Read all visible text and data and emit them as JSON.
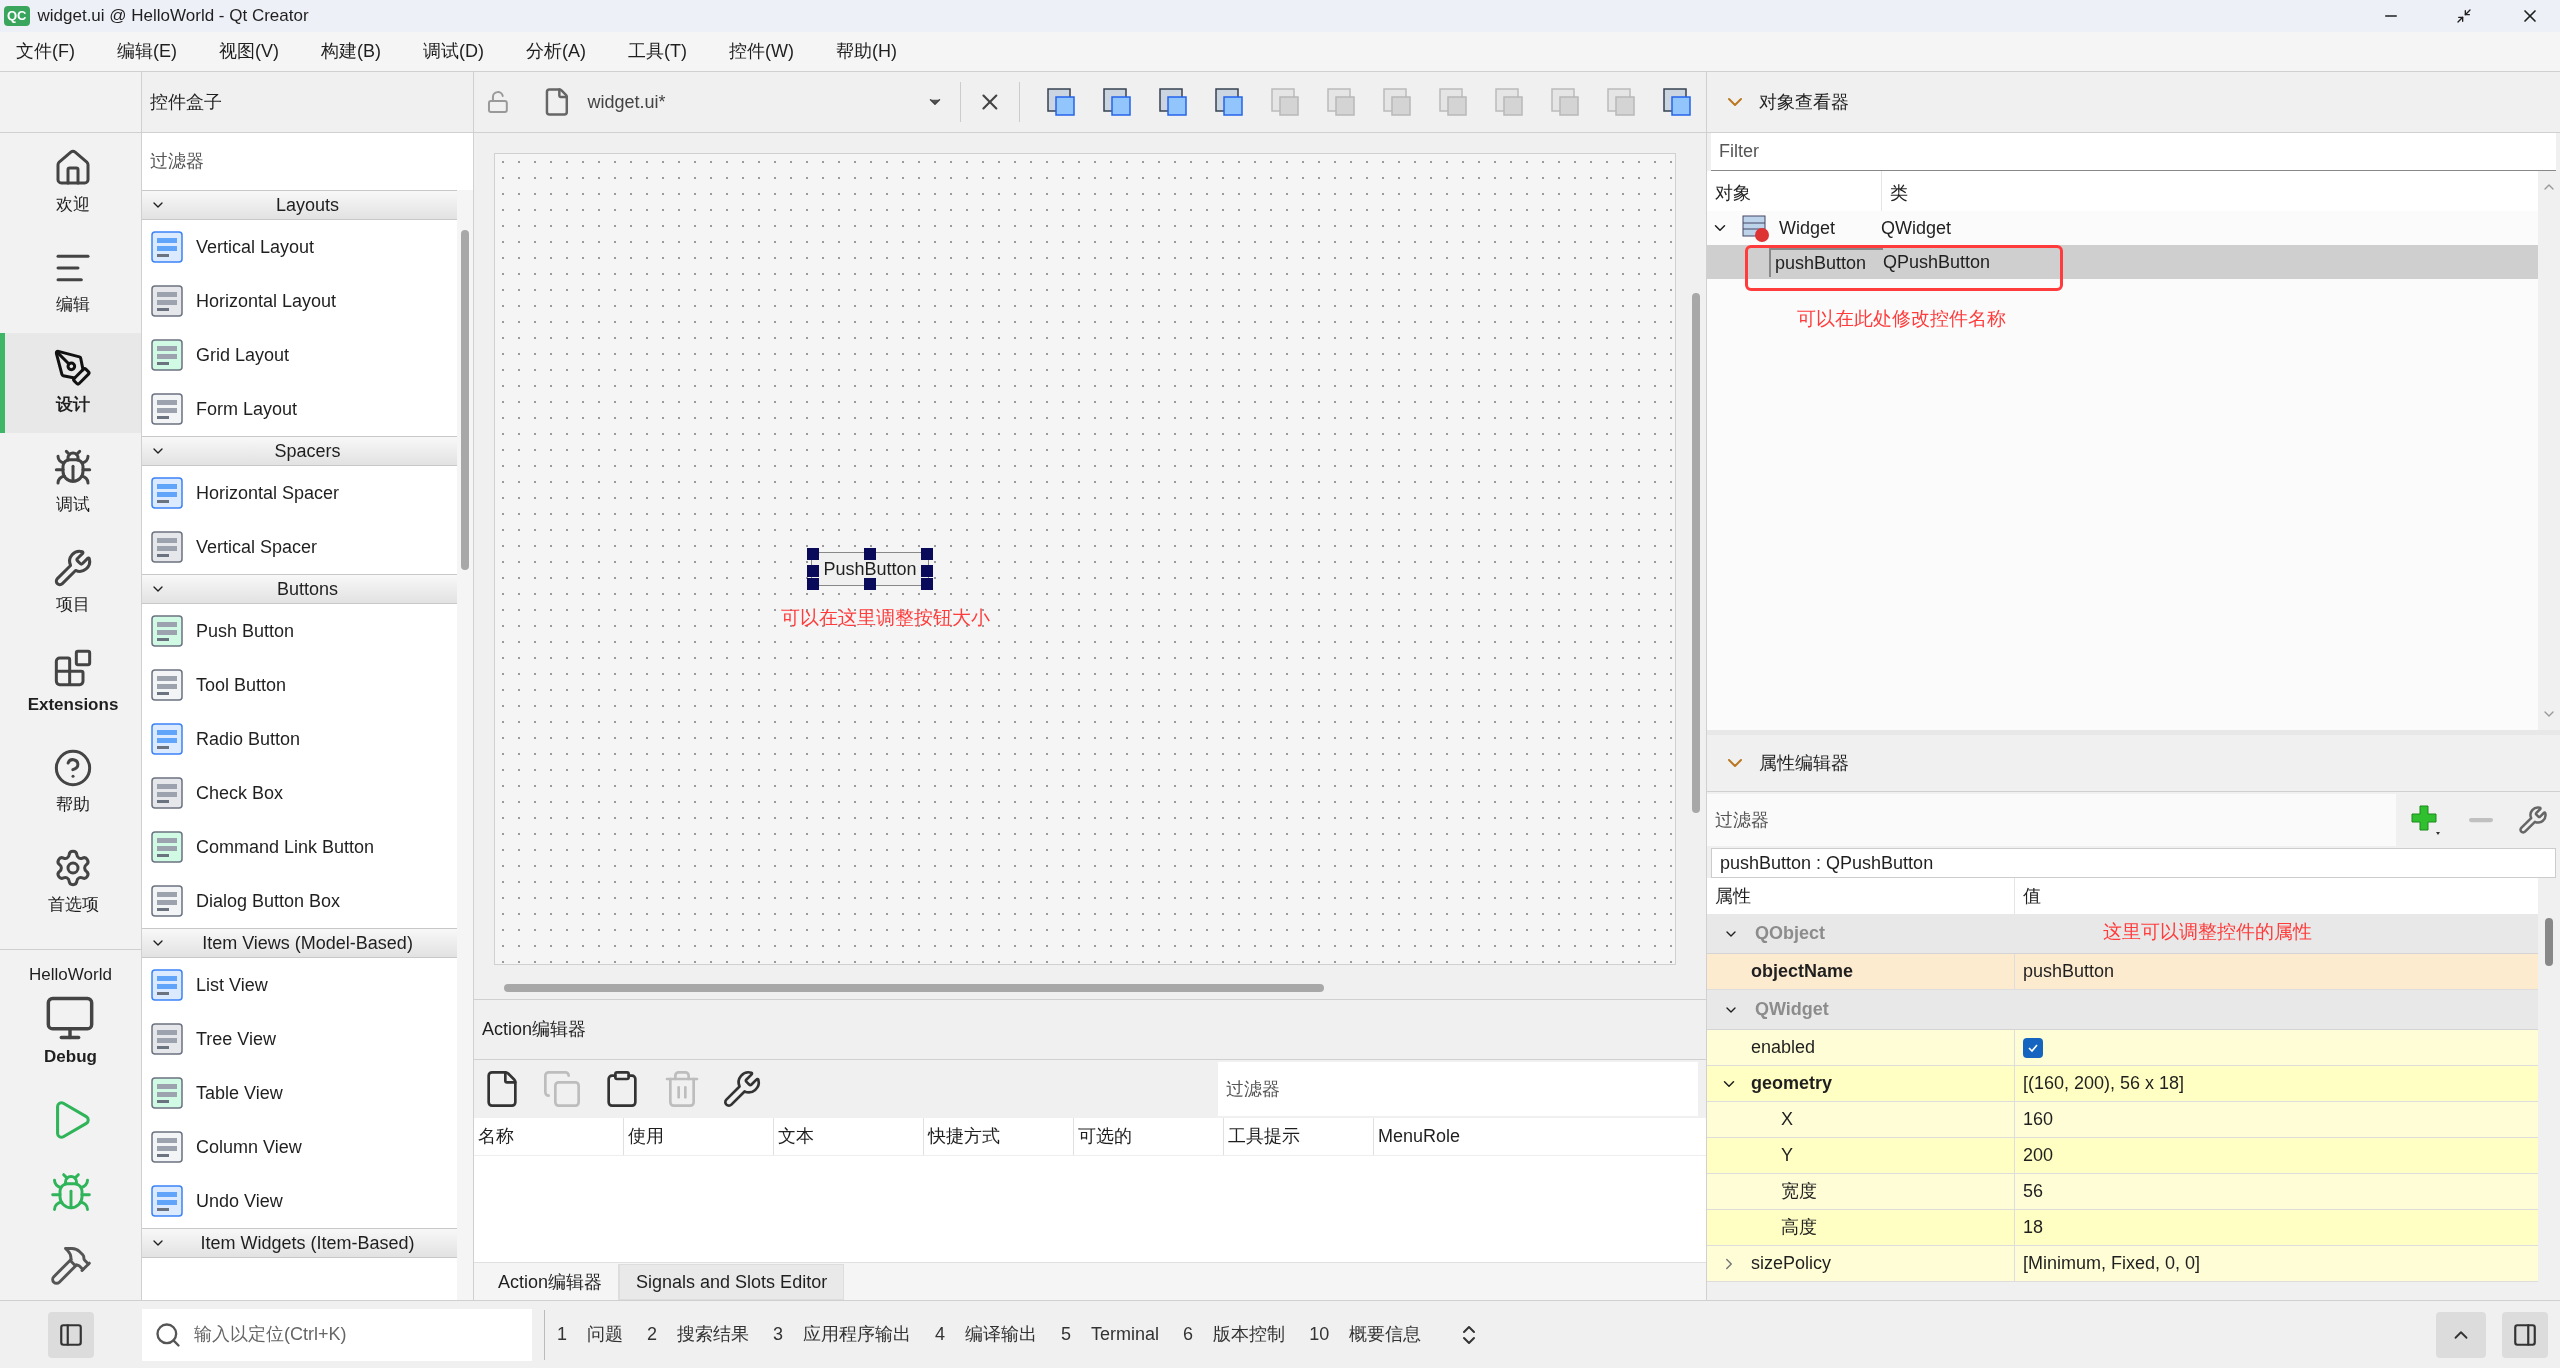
{
  "window": {
    "title": "widget.ui @ HelloWorld - Qt Creator",
    "app_badge": "QC"
  },
  "menu": [
    "文件(F)",
    "编辑(E)",
    "视图(V)",
    "构建(B)",
    "调试(D)",
    "分析(A)",
    "工具(T)",
    "控件(W)",
    "帮助(H)"
  ],
  "mode_bar": {
    "modes": [
      {
        "kind": "home",
        "label": "欢迎",
        "selected": false
      },
      {
        "kind": "edit",
        "label": "编辑",
        "selected": false
      },
      {
        "kind": "design",
        "label": "设计",
        "selected": true
      },
      {
        "kind": "debug",
        "label": "调试",
        "selected": false
      },
      {
        "kind": "project",
        "label": "项目",
        "selected": false
      },
      {
        "kind": "extensions",
        "label": "Extensions",
        "selected": false
      },
      {
        "kind": "help",
        "label": "帮助",
        "selected": false
      },
      {
        "kind": "settings",
        "label": "首选项",
        "selected": false
      }
    ],
    "project": "HelloWorld",
    "build_config": "Debug"
  },
  "widget_box": {
    "title": "控件盒子",
    "filter_placeholder": "过滤器",
    "sections": [
      {
        "name": "Layouts",
        "expanded": true,
        "items": [
          "Vertical Layout",
          "Horizontal Layout",
          "Grid Layout",
          "Form Layout"
        ]
      },
      {
        "name": "Spacers",
        "expanded": true,
        "items": [
          "Horizontal Spacer",
          "Vertical Spacer"
        ]
      },
      {
        "name": "Buttons",
        "expanded": true,
        "items": [
          "Push Button",
          "Tool Button",
          "Radio Button",
          "Check Box",
          "Command Link Button",
          "Dialog Button Box"
        ]
      },
      {
        "name": "Item Views (Model-Based)",
        "expanded": true,
        "items": [
          "List View",
          "Tree View",
          "Table View",
          "Column View",
          "Undo View"
        ]
      },
      {
        "name": "Item Widgets (Item-Based)",
        "expanded": true
      }
    ]
  },
  "editor": {
    "file": "widget.ui*",
    "layout_tools": [
      {
        "disabled": false
      },
      {
        "disabled": false
      },
      {
        "disabled": false
      },
      {
        "disabled": false
      },
      {
        "disabled": true
      },
      {
        "disabled": true
      },
      {
        "disabled": true
      },
      {
        "disabled": true
      },
      {
        "disabled": true
      },
      {
        "disabled": true
      },
      {
        "disabled": true
      },
      {
        "disabled": false
      }
    ],
    "form_button": "PushButton",
    "annotation": "可以在这里调整按钮大小"
  },
  "action_editor": {
    "title": "Action编辑器",
    "filter_placeholder": "过滤器",
    "tools": [
      {
        "kind": "new",
        "disabled": false
      },
      {
        "kind": "copy",
        "disabled": true
      },
      {
        "kind": "paste",
        "disabled": false
      },
      {
        "kind": "delete",
        "disabled": true
      },
      {
        "kind": "settings",
        "disabled": false
      }
    ],
    "columns": [
      "名称",
      "使用",
      "文本",
      "快捷方式",
      "可选的",
      "工具提示",
      "MenuRole"
    ],
    "tabs": [
      {
        "label": "Action编辑器",
        "selected": true
      },
      {
        "label": "Signals and Slots Editor",
        "selected": false
      }
    ]
  },
  "object_inspector": {
    "title": "对象查看器",
    "filter_placeholder": "Filter",
    "columns": [
      "对象",
      "类"
    ],
    "tree": [
      {
        "object": "Widget",
        "class": "QWidget",
        "expanded": true,
        "selected": false,
        "children": [
          {
            "object": "pushButton",
            "class": "QPushButton",
            "selected": true
          }
        ]
      }
    ],
    "annotation": "可以在此处修改控件名称"
  },
  "property_editor": {
    "title": "属性编辑器",
    "filter_placeholder": "过滤器",
    "subject": "pushButton : QPushButton",
    "columns": [
      "属性",
      "值"
    ],
    "annotation": "这里可以调整控件的属性",
    "rows": [
      {
        "kind": "group",
        "name": "QObject",
        "expanded": true
      },
      {
        "kind": "property",
        "name": "objectName",
        "value": "pushButton",
        "modified": true
      },
      {
        "kind": "group",
        "name": "QWidget",
        "expanded": true
      },
      {
        "kind": "checkbox",
        "name": "enabled",
        "checked": true,
        "modified": false
      },
      {
        "kind": "property",
        "name": "geometry",
        "value": "[(160, 200), 56 x 18]",
        "modified": true,
        "expanded": true,
        "children": [
          {
            "name": "X",
            "value": "160"
          },
          {
            "name": "Y",
            "value": "200"
          },
          {
            "name": "宽度",
            "value": "56"
          },
          {
            "name": "高度",
            "value": "18"
          }
        ]
      },
      {
        "kind": "property",
        "name": "sizePolicy",
        "value": "[Minimum, Fixed, 0, 0]",
        "modified": false,
        "expanded": false
      }
    ]
  },
  "status_bar": {
    "locator_placeholder": "输入以定位(Ctrl+K)",
    "panes": [
      {
        "number": "1",
        "label": "问题"
      },
      {
        "number": "2",
        "label": "搜索结果"
      },
      {
        "number": "3",
        "label": "应用程序输出"
      },
      {
        "number": "4",
        "label": "编译输出"
      },
      {
        "number": "5",
        "label": "Terminal"
      },
      {
        "number": "6",
        "label": "版本控制"
      },
      {
        "number": "10",
        "label": "概要信息"
      }
    ]
  }
}
